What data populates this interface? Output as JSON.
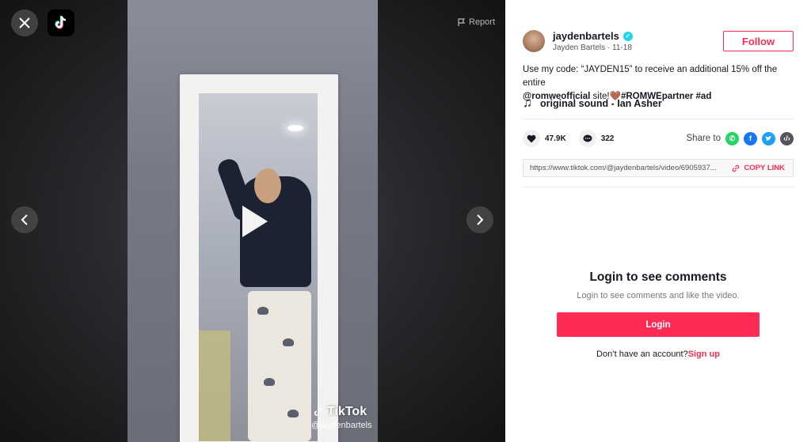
{
  "player": {
    "report_label": "Report",
    "watermark_brand": "TikTok",
    "watermark_handle": "@jaydenbartels"
  },
  "author": {
    "username": "jaydenbartels",
    "display_name": "Jayden Bartels",
    "date": "11-18",
    "follow_label": "Follow"
  },
  "description": {
    "text_before": "Use my code: “JAYDEN15” to receive an additional 15% off the entire",
    "mention": "@romweofficial",
    "text_middle": " site!",
    "emoji": "🤎",
    "hashtag1": "#ROMWEpartner",
    "hashtag2": " #ad"
  },
  "sound": {
    "title": "original sound - Ian Asher"
  },
  "stats": {
    "likes": "47.9K",
    "comments": "322",
    "share_label": "Share to"
  },
  "link": {
    "url": "https://www.tiktok.com/@jaydenbartels/video/6905937...",
    "copy_label": "COPY LINK"
  },
  "login": {
    "title": "Login to see comments",
    "subtitle": "Login to see comments and like the video.",
    "button_label": "Login",
    "no_account": "Don’t have an account?",
    "signup_label": "Sign up"
  },
  "colors": {
    "accent": "#fe2c55",
    "verified": "#20d5ec",
    "whatsapp": "#25d366",
    "facebook": "#1877f2",
    "twitter": "#1da1f2",
    "embed": "#55565c"
  }
}
